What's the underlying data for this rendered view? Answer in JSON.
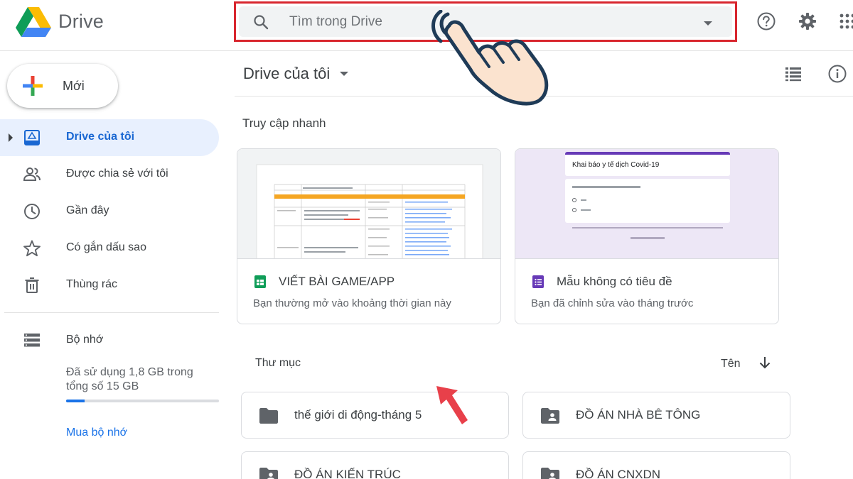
{
  "app": {
    "name": "Drive"
  },
  "search": {
    "placeholder": "Tìm trong Drive"
  },
  "sidebar": {
    "new_label": "Mới",
    "items": [
      {
        "label": "Drive của tôi",
        "active": true
      },
      {
        "label": "Được chia sẻ với tôi"
      },
      {
        "label": "Gần đây"
      },
      {
        "label": "Có gắn dấu sao"
      },
      {
        "label": "Thùng rác"
      }
    ],
    "storage": {
      "title": "Bộ nhớ",
      "usage": "Đã sử dụng 1,8 GB trong tổng số 15 GB",
      "used_fraction": 0.12,
      "buy_label": "Mua bộ nhớ"
    }
  },
  "main": {
    "title": "Drive của tôi",
    "quick_access_label": "Truy cập nhanh",
    "quick_access": [
      {
        "name": "VIẾT BÀI GAME/APP",
        "subtitle": "Bạn thường mở vào khoảng thời gian này",
        "type_icon": "sheets-icon"
      },
      {
        "name": "Mẫu không có tiêu đề",
        "subtitle": "Bạn đã chỉnh sửa vào tháng trước",
        "type_icon": "forms-icon",
        "preview": {
          "form_title": "Khai báo y tế dịch Covid-19"
        }
      }
    ],
    "folders_label": "Thư mục",
    "sort_label": "Tên",
    "folders": [
      {
        "name": "thế giới di động-tháng 5",
        "shared": false
      },
      {
        "name": "ĐỒ ÁN NHÀ BÊ TÔNG",
        "shared": true
      },
      {
        "name": "ĐỒ ÁN KIẾN TRÚC",
        "shared": true
      },
      {
        "name": "ĐỒ ÁN CNXDN",
        "shared": true
      }
    ]
  },
  "colors": {
    "accent": "#1a73e8",
    "active_bg": "#e8f0fe",
    "highlight_border": "#d8262e",
    "annotation_arrow": "#e8404a"
  }
}
